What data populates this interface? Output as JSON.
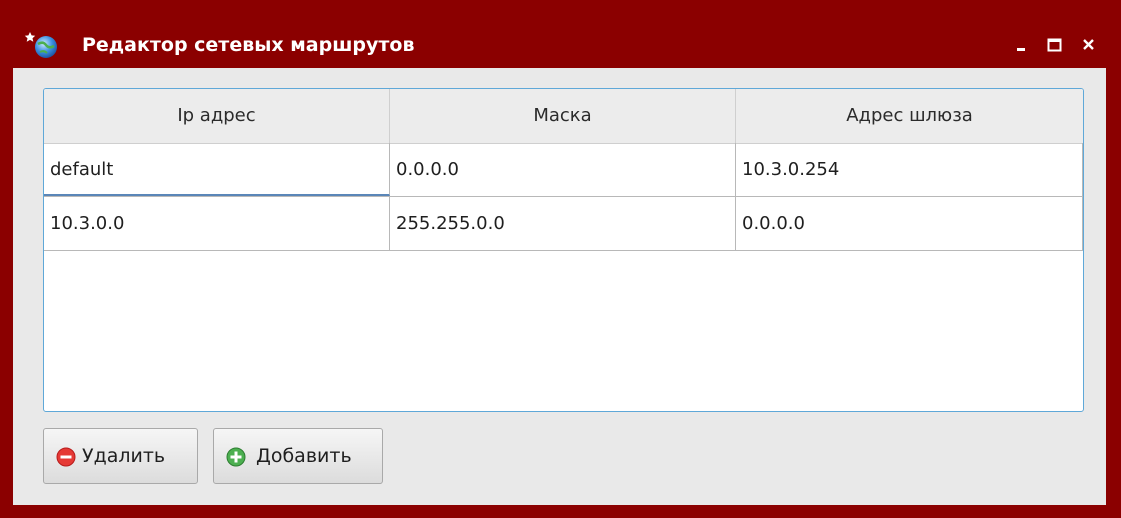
{
  "window": {
    "title": "Редактор сетевых маршрутов",
    "icons": {
      "app": "globe-star-icon",
      "minimize": "minimize-icon",
      "maximize": "maximize-icon",
      "close": "close-icon"
    },
    "colors": {
      "titlebar": "#8b0000",
      "client": "#e9e9e9",
      "selection_border": "#5fa8d8"
    }
  },
  "routes_table": {
    "headers": [
      "Ip адрес",
      "Маска",
      "Адрес шлюза"
    ],
    "rows": [
      [
        "default",
        "0.0.0.0",
        "10.3.0.254"
      ],
      [
        "10.3.0.0",
        "255.255.0.0",
        "0.0.0.0"
      ]
    ]
  },
  "buttons": {
    "delete": {
      "label": "Удалить",
      "icon": "remove-icon"
    },
    "add": {
      "label": "Добавить",
      "icon": "add-icon"
    }
  }
}
